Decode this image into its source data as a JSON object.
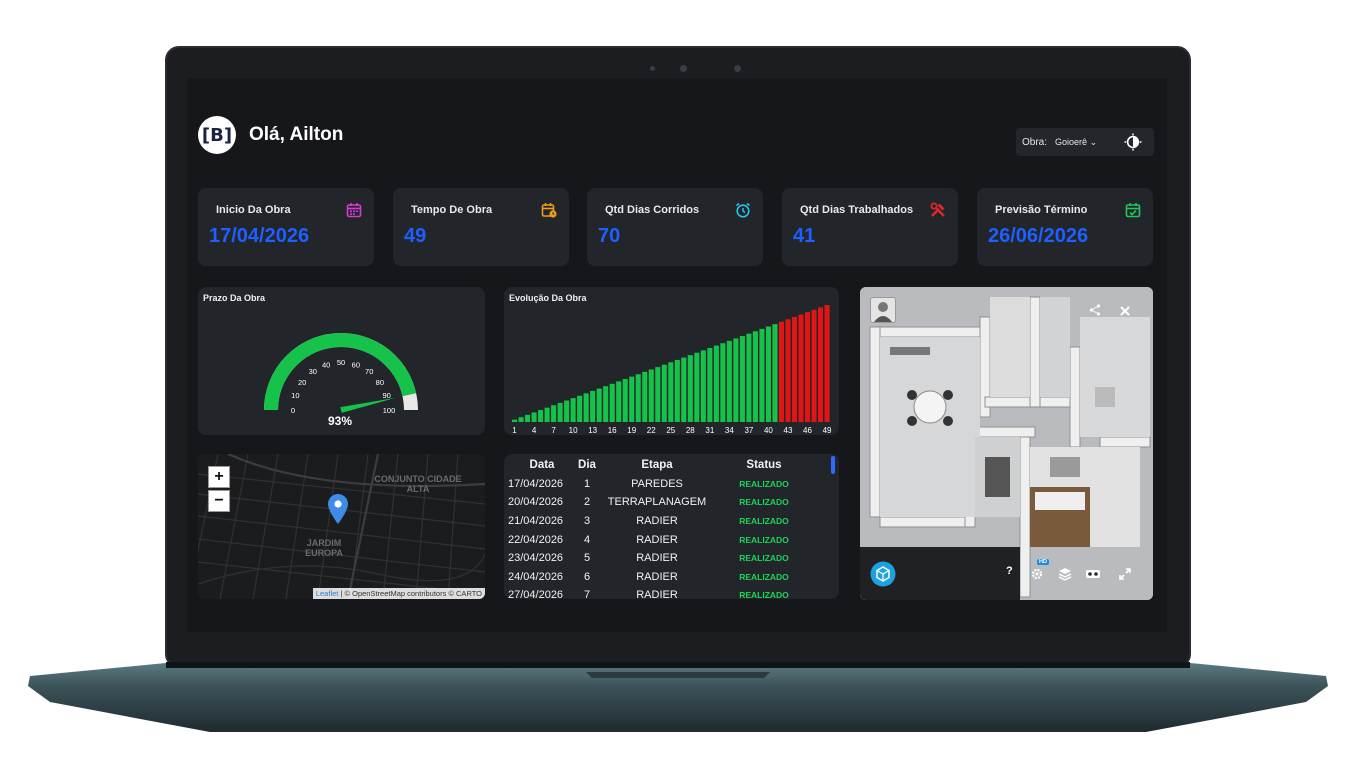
{
  "header": {
    "logo_text": "[B]",
    "greeting": "Olá, Ailton",
    "obra_label": "Obra:",
    "obra_value": "Goioerê"
  },
  "kpis": [
    {
      "title": "Inicio Da Obra",
      "value": "17/04/2026",
      "icon": "calendar-icon",
      "color": "#d63ad6"
    },
    {
      "title": "Tempo De Obra",
      "value": "49",
      "icon": "calendar-clock-icon",
      "color": "#f39a1e"
    },
    {
      "title": "Qtd Dias Corridos",
      "value": "70",
      "icon": "alarm-clock-icon",
      "color": "#22c6e6"
    },
    {
      "title": "Qtd Dias Trabalhados",
      "value": "41",
      "icon": "tools-icon",
      "color": "#e3262e"
    },
    {
      "title": "Previsão Término",
      "value": "26/06/2026",
      "icon": "calendar-check-icon",
      "color": "#22c55e"
    }
  ],
  "gauge": {
    "title": "Prazo Da Obra",
    "value_label": "93%",
    "value": 93,
    "ticks": [
      "0",
      "10",
      "20",
      "30",
      "40",
      "50",
      "60",
      "70",
      "80",
      "90",
      "100"
    ]
  },
  "chart_data": {
    "type": "bar",
    "title": "Evolução Da Obra",
    "xlabel": "",
    "ylabel": "",
    "x": [
      1,
      2,
      3,
      4,
      5,
      6,
      7,
      8,
      9,
      10,
      11,
      12,
      13,
      14,
      15,
      16,
      17,
      18,
      19,
      20,
      21,
      22,
      23,
      24,
      25,
      26,
      27,
      28,
      29,
      30,
      31,
      32,
      33,
      34,
      35,
      36,
      37,
      38,
      39,
      40,
      41,
      42,
      43,
      44,
      45,
      46,
      47,
      48,
      49
    ],
    "x_tick_labels": [
      "1",
      "4",
      "7",
      "10",
      "13",
      "16",
      "19",
      "22",
      "25",
      "28",
      "31",
      "34",
      "37",
      "40",
      "43",
      "46",
      "49"
    ],
    "values": [
      1,
      2,
      3,
      4,
      5,
      6,
      7,
      8,
      9,
      10,
      11,
      12,
      13,
      14,
      15,
      16,
      17,
      18,
      19,
      20,
      21,
      22,
      23,
      24,
      25,
      26,
      27,
      28,
      29,
      30,
      31,
      32,
      33,
      34,
      35,
      36,
      37,
      38,
      39,
      40,
      41,
      42,
      43,
      44,
      45,
      46,
      47,
      48,
      49
    ],
    "green_until": 41,
    "colors": {
      "done": "#16c24a",
      "late": "#e01515"
    }
  },
  "map": {
    "labels": [
      "CONJUNTO CIDADE ALTA",
      "JARDIM EUROPA"
    ],
    "zoom_in": "+",
    "zoom_out": "−",
    "attribution_link": "Leaflet",
    "attribution_text": "| © OpenStreetMap contributors © CARTO"
  },
  "table": {
    "headers": [
      "Data",
      "Dia",
      "Etapa",
      "Status"
    ],
    "rows": [
      [
        "17/04/2026",
        "1",
        "PAREDES",
        "REALIZADO"
      ],
      [
        "20/04/2026",
        "2",
        "TERRAPLANAGEM",
        "REALIZADO"
      ],
      [
        "21/04/2026",
        "3",
        "RADIER",
        "REALIZADO"
      ],
      [
        "22/04/2026",
        "4",
        "RADIER",
        "REALIZADO"
      ],
      [
        "23/04/2026",
        "5",
        "RADIER",
        "REALIZADO"
      ],
      [
        "24/04/2026",
        "6",
        "RADIER",
        "REALIZADO"
      ],
      [
        "27/04/2026",
        "7",
        "RADIER",
        "REALIZADO"
      ]
    ]
  },
  "tour": {
    "hd_badge": "HD",
    "help": "?"
  }
}
